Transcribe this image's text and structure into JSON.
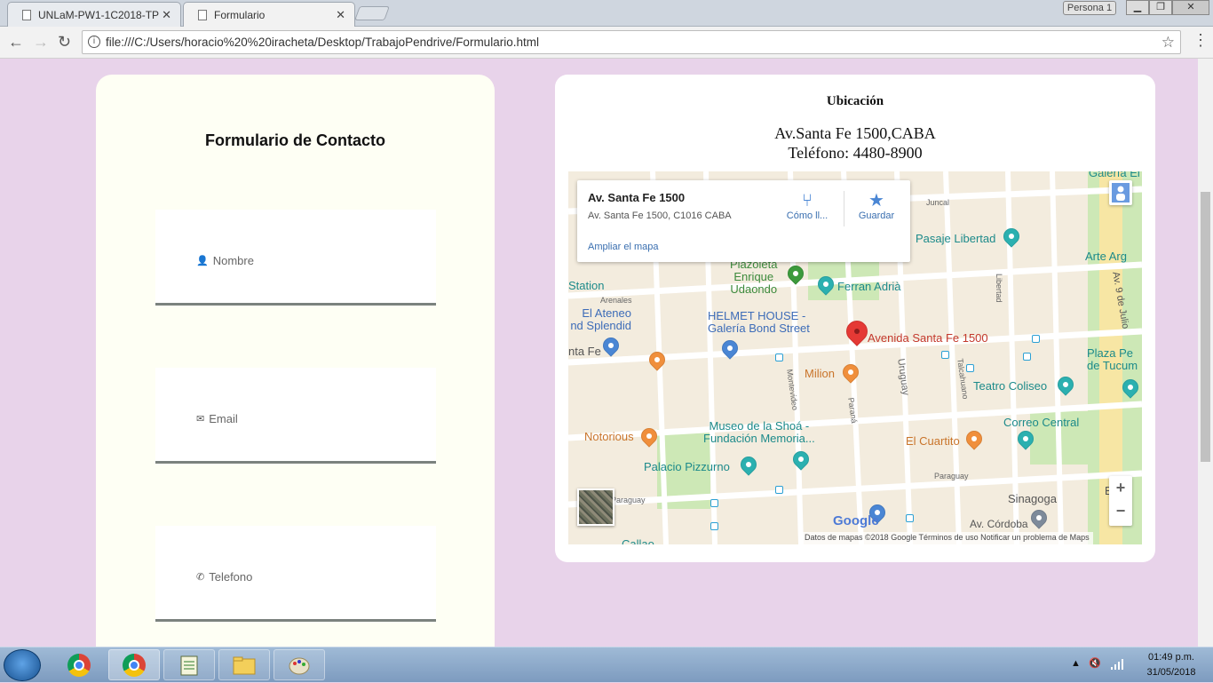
{
  "browser": {
    "tabs": [
      {
        "title": "UNLaM-PW1-1C2018-TP",
        "active": false
      },
      {
        "title": "Formulario",
        "active": true
      }
    ],
    "profile": "Persona 1",
    "url": "file:///C:/Users/horacio%20%20iracheta/Desktop/TrabajoPendrive/Formulario.html"
  },
  "form": {
    "title": "Formulario de Contacto",
    "fields": [
      {
        "label": "Nombre",
        "icon": "person-icon"
      },
      {
        "label": "Email",
        "icon": "envelope-icon"
      },
      {
        "label": "Telefono",
        "icon": "phone-icon"
      }
    ]
  },
  "location": {
    "title": "Ubicación",
    "address": "Av.Santa Fe 1500,CABA",
    "phone": "Teléfono: 4480-8900"
  },
  "map": {
    "infobox": {
      "name": "Av. Santa Fe 1500",
      "address": "Av. Santa Fe 1500, C1016 CABA",
      "directions": "Cómo ll...",
      "save": "Guardar",
      "enlarge": "Ampliar el mapa"
    },
    "labels": {
      "pasaje_libertad": "Pasaje Libertad",
      "plazoleta": "Plazoleta\nEnrique\nUdaondo",
      "ferran": "Ferran Adrià",
      "station": "Station",
      "ateneo": "El Ateneo\nnd Splendid",
      "helmet": "HELMET HOUSE -\nGalería Bond Street",
      "marker": "Avenida Santa Fe 1500",
      "milion": "Milion",
      "teatro": "Teatro Coliseo",
      "correo": "Correo Central",
      "cuartito": "El Cuartito",
      "notorious": "Notorious",
      "museo": "Museo de la Shoá -\nFundación Memoria...",
      "pizzurno": "Palacio Pizzurno",
      "sinagoga": "Sinagoga",
      "arte": "Arte Arg",
      "plaza": "Plaza Pe\nde Tucum",
      "galeria": "Galería El",
      "bue": "Bue",
      "sfe": "nta Fe",
      "callao": "Callao"
    },
    "streets": {
      "juncal": "Juncal",
      "arenales": "Arenales",
      "libertad": "Libertad",
      "av9": "Av. 9 de Julio",
      "uruguay": "Uruguay",
      "talcahuano": "Talcahuano",
      "montevideo": "Montevideo",
      "parana": "Paraná",
      "paraguay": "Paraguay",
      "paraguay2": "Paraguay",
      "cordoba": "Av. Córdoba"
    },
    "google": "Google",
    "attribution": "Datos de mapas ©2018 Google   Términos de uso   Notificar un problema de Maps",
    "zoom_in": "+",
    "zoom_out": "−"
  },
  "taskbar": {
    "time": "01:49 p.m.",
    "date": "31/05/2018"
  }
}
